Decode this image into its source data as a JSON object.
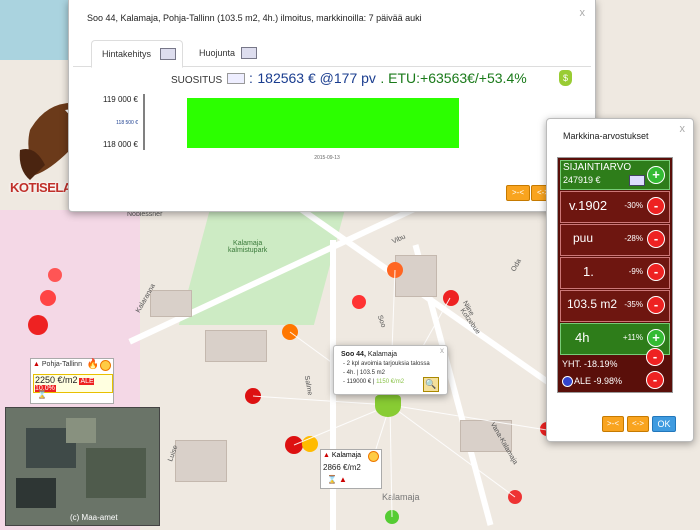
{
  "main_panel": {
    "title": "Soo 44, Kalamaja, Pohja-Tallinn (103.5 m2, 4h.) ilmoitus, markkinoilla: 7 päivää auki",
    "close": "x",
    "tabs": [
      "Hintakehitys",
      "Huojunta"
    ],
    "suositus_label": "SUOSITUS",
    "price": "182563 € @177 pv",
    "etu": ". ETU:+63563€/+53.4%",
    "chart_date": "2015-09-13",
    "buttons": [
      ">-<",
      "<->"
    ]
  },
  "chart_data": {
    "type": "bar",
    "title": "",
    "y_ticks": [
      "119 000 €",
      "118 500 €",
      "118 000 €"
    ],
    "ylim": [
      118000,
      119000
    ],
    "x_label": "2015-09-13",
    "bar": {
      "from": 118000,
      "to": 119000,
      "color": "#2cff00"
    }
  },
  "market_panel": {
    "title": "Markkina-arvostukset",
    "close": "x",
    "sijainti_label": "SIJAINTIARVO",
    "sijainti_value": "247919 €",
    "rows": [
      {
        "label": "v.1902",
        "pct": "-30%",
        "action": "-"
      },
      {
        "label": "puu",
        "pct": "-28%",
        "action": "-"
      },
      {
        "label": "1.",
        "pct": "-9%",
        "action": "-"
      },
      {
        "label": "103.5 m2",
        "pct": "-35%",
        "action": "-"
      },
      {
        "label": "4h",
        "pct": "+11%",
        "action": "+"
      }
    ],
    "yht": "YHT. -18.19%",
    "ale": "ALE -9.98%",
    "buttons": [
      ">-<",
      "<->",
      "OK"
    ]
  },
  "popup": {
    "title_bold": "Soo 44,",
    "title_rest": " Kalamaja",
    "lines": [
      "- 2 kpl avoimia tarjouksia talossa",
      "- 4h. | 103.5 m2"
    ],
    "price_line_a": "- 119000 € |",
    "price_line_b": " 1150 €/m2",
    "close": "x"
  },
  "pohja_label": {
    "name": "Pohja-Tallinn",
    "price": "2250 €/m2",
    "ale": "ALE 10,0%"
  },
  "kalamaja_label": {
    "name": "Kalamaja",
    "price": "2866 €/m2"
  },
  "logo_text": "KOTISELAIN",
  "satellite_credit": "(c) Maa-amet",
  "map_labels": {
    "noblessner": "Noblessner",
    "park": "Kalamaja\nkalmistupark",
    "kalamaja": "Kalamaja",
    "streets": [
      "Vibu",
      "Oda",
      "Kotzebue",
      "Soo",
      "Niine",
      "Vana-Kalamaja",
      "Kalaranna",
      "Luise",
      "Salme"
    ]
  },
  "colors": {
    "accent": "#f9a41f",
    "chart_bar": "#2cff00",
    "market_bg": "#5a0f0a"
  }
}
